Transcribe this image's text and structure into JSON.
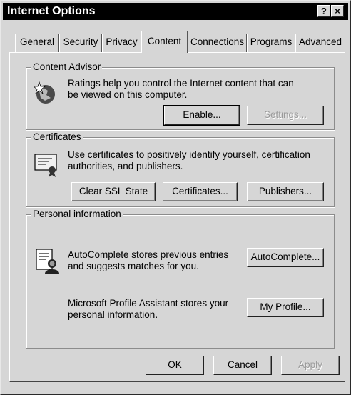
{
  "window": {
    "title": "Internet Options",
    "help_label": "?",
    "close_label": "×"
  },
  "tabs": [
    {
      "label": "General"
    },
    {
      "label": "Security"
    },
    {
      "label": "Privacy"
    },
    {
      "label": "Content",
      "active": true
    },
    {
      "label": "Connections"
    },
    {
      "label": "Programs"
    },
    {
      "label": "Advanced"
    }
  ],
  "content_advisor": {
    "title": "Content Advisor",
    "description": "Ratings help you control the Internet content that can be viewed on this computer.",
    "enable_label": "Enable...",
    "settings_label": "Settings...",
    "icon": "content-advisor-icon"
  },
  "certificates": {
    "title": "Certificates",
    "description": "Use certificates to positively identify yourself, certification authorities, and publishers.",
    "clear_ssl_label": "Clear SSL State",
    "certificates_label": "Certificates...",
    "publishers_label": "Publishers...",
    "icon": "certificate-icon"
  },
  "personal_information": {
    "title": "Personal information",
    "autocomplete_text": "AutoComplete stores previous entries and suggests matches for you.",
    "autocomplete_label": "AutoComplete...",
    "profile_text": "Microsoft Profile Assistant stores your personal information.",
    "profile_label": "My Profile...",
    "icon": "profile-icon"
  },
  "footer": {
    "ok_label": "OK",
    "cancel_label": "Cancel",
    "apply_label": "Apply"
  },
  "colors": {
    "face": "#d6d6d6",
    "titlebar": "#000000",
    "disabled_text": "#9a9a9a"
  }
}
